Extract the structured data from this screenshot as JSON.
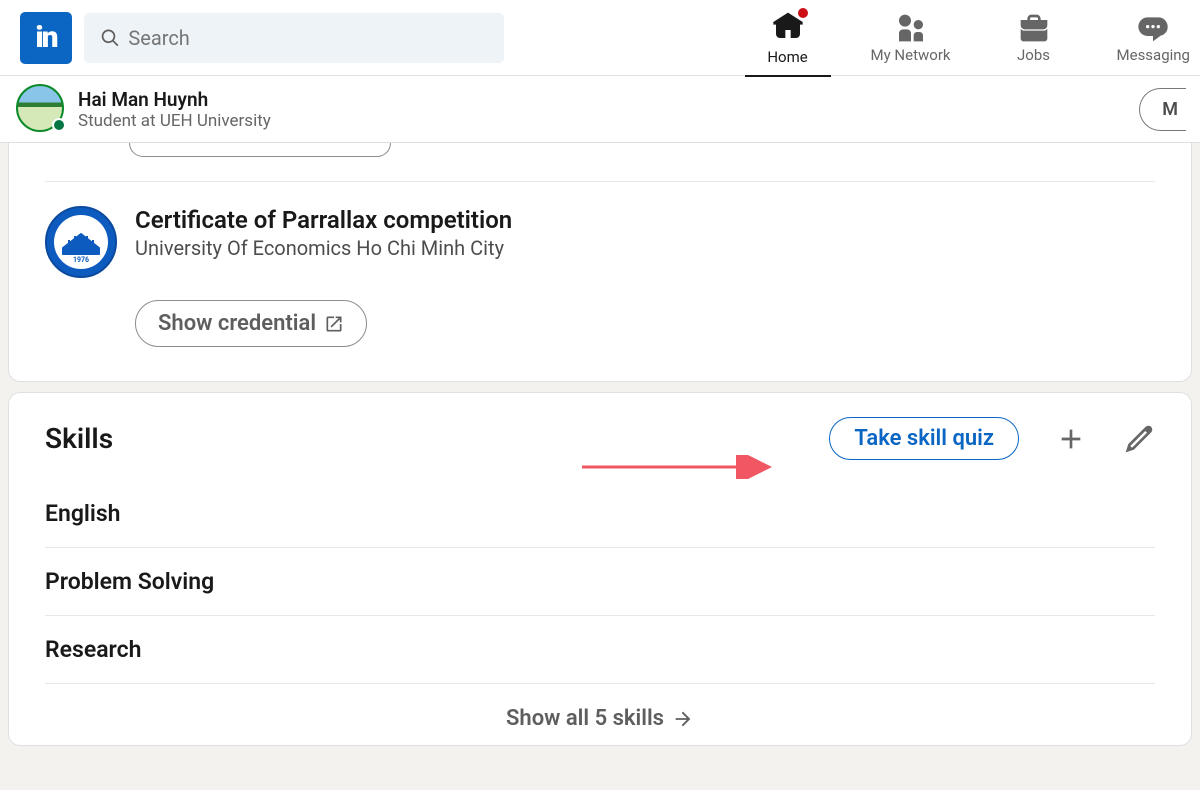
{
  "search": {
    "placeholder": "Search"
  },
  "nav": {
    "home": "Home",
    "network": "My Network",
    "jobs": "Jobs",
    "messaging": "Messaging"
  },
  "profile": {
    "name": "Hai Man Huynh",
    "headline": "Student at UEH University",
    "more_label": "M"
  },
  "certificate": {
    "title": "Certificate of Parrallax competition",
    "issuer": "University Of Economics Ho Chi Minh City",
    "show_credential_label": "Show credential"
  },
  "skills": {
    "section_title": "Skills",
    "quiz_button_label": "Take skill quiz",
    "items": [
      "English",
      "Problem Solving",
      "Research"
    ],
    "show_all_label": "Show all 5 skills"
  }
}
